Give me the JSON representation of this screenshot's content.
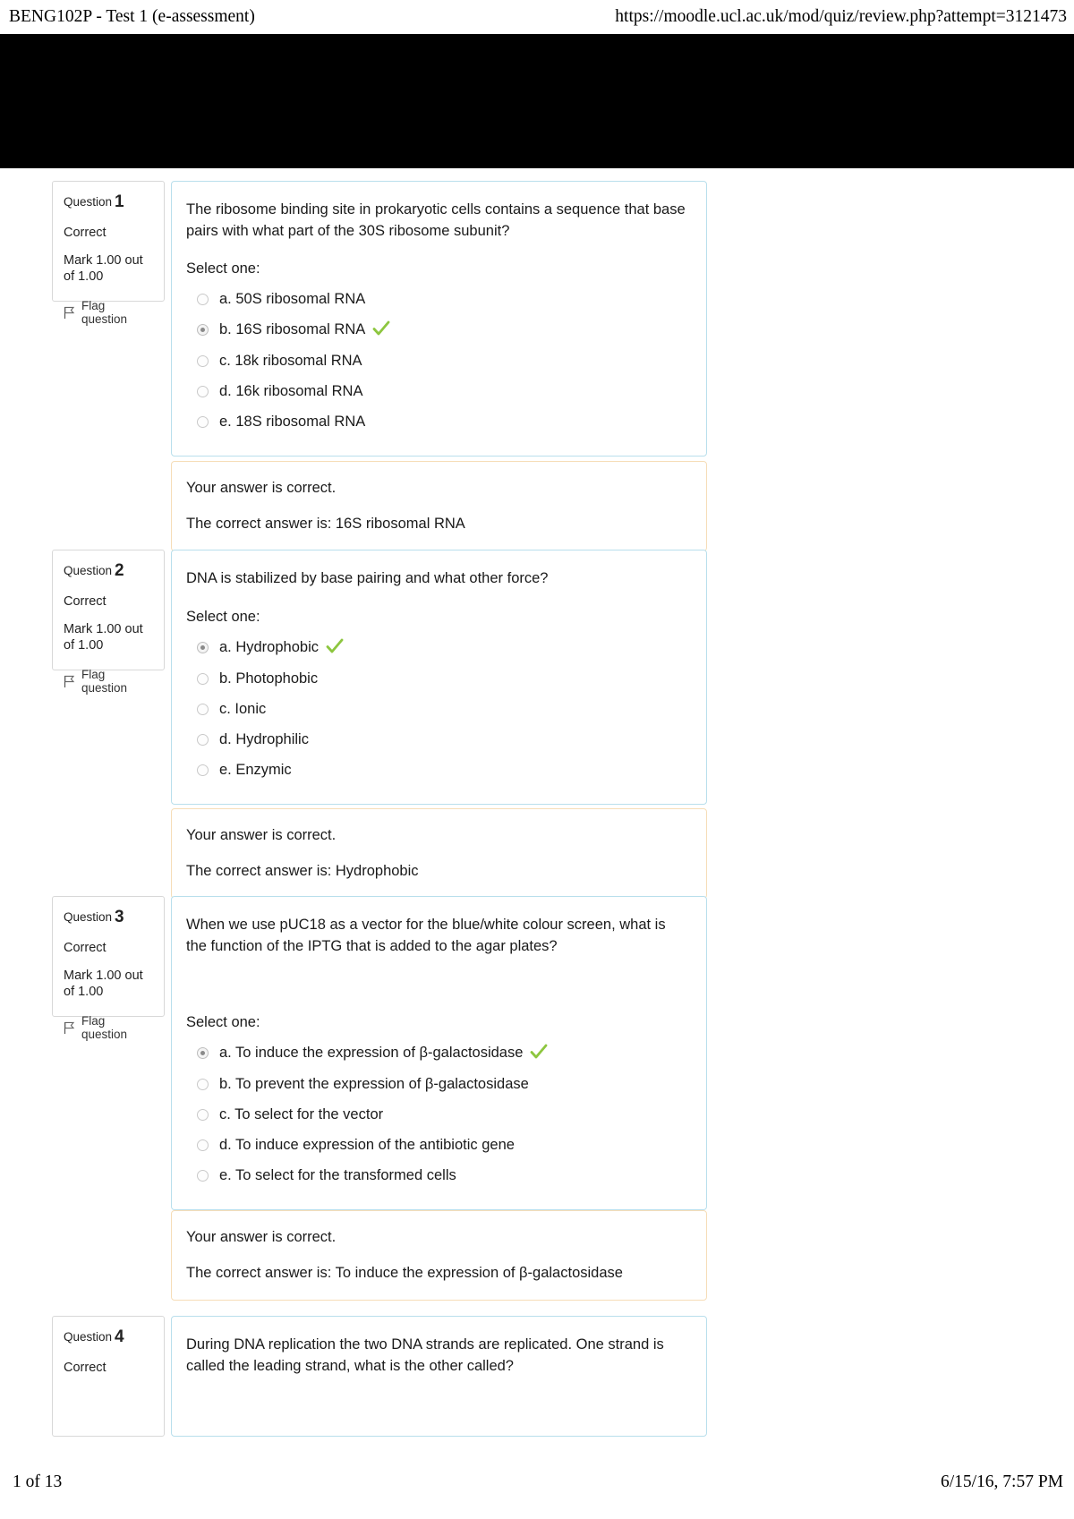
{
  "print_header": {
    "left": "BENG102P - Test 1 (e-assessment)",
    "right": "https://moodle.ucl.ac.uk/mod/quiz/review.php?attempt=3121473"
  },
  "print_footer": {
    "left": "1 of 13",
    "right": "6/15/16, 7:57 PM"
  },
  "labels": {
    "question_word": "Question",
    "select_one": "Select one:",
    "flag_question": "Flag question"
  },
  "colors": {
    "question_border": "#b9dfec",
    "feedback_border": "#f6ddb8",
    "info_border": "#d8d8d8",
    "tick_green": "#8dc63f",
    "banner": "#000000"
  },
  "questions": [
    {
      "number": "1",
      "state": "Correct",
      "grade": "Mark 1.00 out of 1.00",
      "flag": "Flag question",
      "text": "The ribosome binding site in prokaryotic cells contains a sequence that base pairs with what part of the 30S ribosome subunit?",
      "options": [
        {
          "label": "a. 50S ribosomal RNA",
          "selected": false,
          "correct": false
        },
        {
          "label": "b. 16S ribosomal RNA",
          "selected": true,
          "correct": true
        },
        {
          "label": "c. 18k ribosomal RNA",
          "selected": false,
          "correct": false
        },
        {
          "label": "d. 16k ribosomal RNA",
          "selected": false,
          "correct": false
        },
        {
          "label": "e. 18S ribosomal RNA",
          "selected": false,
          "correct": false
        }
      ],
      "feedback_result": "Your answer is correct.",
      "feedback_answer": "The correct answer is: 16S ribosomal RNA"
    },
    {
      "number": "2",
      "state": "Correct",
      "grade": "Mark 1.00 out of 1.00",
      "flag": "Flag question",
      "text": "DNA is stabilized by base pairing and what other force?",
      "options": [
        {
          "label": "a. Hydrophobic",
          "selected": true,
          "correct": true
        },
        {
          "label": "b. Photophobic",
          "selected": false,
          "correct": false
        },
        {
          "label": "c. Ionic",
          "selected": false,
          "correct": false
        },
        {
          "label": "d. Hydrophilic",
          "selected": false,
          "correct": false
        },
        {
          "label": "e. Enzymic",
          "selected": false,
          "correct": false
        }
      ],
      "feedback_result": "Your answer is correct.",
      "feedback_answer": "The correct answer is: Hydrophobic"
    },
    {
      "number": "3",
      "state": "Correct",
      "grade": "Mark 1.00 out of 1.00",
      "flag": "Flag question",
      "text": "When we use pUC18 as a vector for the blue/white colour screen, what is the function of the IPTG that is added to the agar plates?",
      "options": [
        {
          "label": "a. To induce the expression of β-galactosidase",
          "selected": true,
          "correct": true
        },
        {
          "label": "b. To prevent the expression of β-galactosidase",
          "selected": false,
          "correct": false
        },
        {
          "label": "c. To select for the vector",
          "selected": false,
          "correct": false
        },
        {
          "label": "d. To induce expression of the antibiotic gene",
          "selected": false,
          "correct": false
        },
        {
          "label": "e. To select for the transformed cells",
          "selected": false,
          "correct": false
        }
      ],
      "feedback_result": "Your answer is correct.",
      "feedback_answer": "The correct answer is: To induce the expression of β-galactosidase"
    },
    {
      "number": "4",
      "state": "Correct",
      "grade": "",
      "flag": "",
      "text": "During DNA replication the two DNA strands are replicated. One strand is called the leading strand, what is the other called?",
      "options": [],
      "feedback_result": "",
      "feedback_answer": ""
    }
  ]
}
